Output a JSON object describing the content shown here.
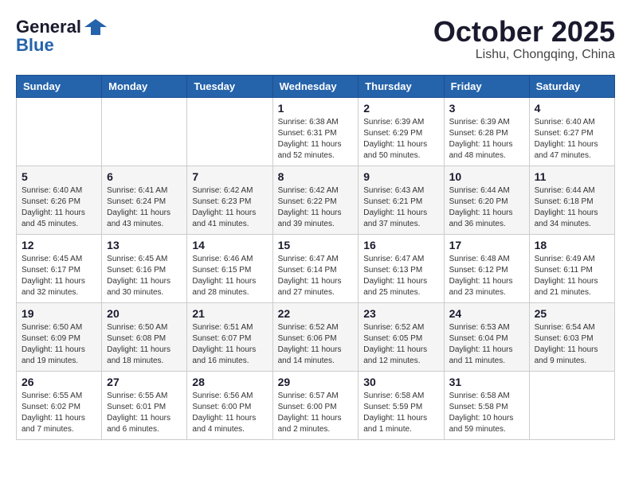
{
  "header": {
    "logo_general": "General",
    "logo_blue": "Blue",
    "month": "October 2025",
    "location": "Lishu, Chongqing, China"
  },
  "days_of_week": [
    "Sunday",
    "Monday",
    "Tuesday",
    "Wednesday",
    "Thursday",
    "Friday",
    "Saturday"
  ],
  "weeks": [
    [
      {
        "day": "",
        "info": ""
      },
      {
        "day": "",
        "info": ""
      },
      {
        "day": "",
        "info": ""
      },
      {
        "day": "1",
        "info": "Sunrise: 6:38 AM\nSunset: 6:31 PM\nDaylight: 11 hours and 52 minutes."
      },
      {
        "day": "2",
        "info": "Sunrise: 6:39 AM\nSunset: 6:29 PM\nDaylight: 11 hours and 50 minutes."
      },
      {
        "day": "3",
        "info": "Sunrise: 6:39 AM\nSunset: 6:28 PM\nDaylight: 11 hours and 48 minutes."
      },
      {
        "day": "4",
        "info": "Sunrise: 6:40 AM\nSunset: 6:27 PM\nDaylight: 11 hours and 47 minutes."
      }
    ],
    [
      {
        "day": "5",
        "info": "Sunrise: 6:40 AM\nSunset: 6:26 PM\nDaylight: 11 hours and 45 minutes."
      },
      {
        "day": "6",
        "info": "Sunrise: 6:41 AM\nSunset: 6:24 PM\nDaylight: 11 hours and 43 minutes."
      },
      {
        "day": "7",
        "info": "Sunrise: 6:42 AM\nSunset: 6:23 PM\nDaylight: 11 hours and 41 minutes."
      },
      {
        "day": "8",
        "info": "Sunrise: 6:42 AM\nSunset: 6:22 PM\nDaylight: 11 hours and 39 minutes."
      },
      {
        "day": "9",
        "info": "Sunrise: 6:43 AM\nSunset: 6:21 PM\nDaylight: 11 hours and 37 minutes."
      },
      {
        "day": "10",
        "info": "Sunrise: 6:44 AM\nSunset: 6:20 PM\nDaylight: 11 hours and 36 minutes."
      },
      {
        "day": "11",
        "info": "Sunrise: 6:44 AM\nSunset: 6:18 PM\nDaylight: 11 hours and 34 minutes."
      }
    ],
    [
      {
        "day": "12",
        "info": "Sunrise: 6:45 AM\nSunset: 6:17 PM\nDaylight: 11 hours and 32 minutes."
      },
      {
        "day": "13",
        "info": "Sunrise: 6:45 AM\nSunset: 6:16 PM\nDaylight: 11 hours and 30 minutes."
      },
      {
        "day": "14",
        "info": "Sunrise: 6:46 AM\nSunset: 6:15 PM\nDaylight: 11 hours and 28 minutes."
      },
      {
        "day": "15",
        "info": "Sunrise: 6:47 AM\nSunset: 6:14 PM\nDaylight: 11 hours and 27 minutes."
      },
      {
        "day": "16",
        "info": "Sunrise: 6:47 AM\nSunset: 6:13 PM\nDaylight: 11 hours and 25 minutes."
      },
      {
        "day": "17",
        "info": "Sunrise: 6:48 AM\nSunset: 6:12 PM\nDaylight: 11 hours and 23 minutes."
      },
      {
        "day": "18",
        "info": "Sunrise: 6:49 AM\nSunset: 6:11 PM\nDaylight: 11 hours and 21 minutes."
      }
    ],
    [
      {
        "day": "19",
        "info": "Sunrise: 6:50 AM\nSunset: 6:09 PM\nDaylight: 11 hours and 19 minutes."
      },
      {
        "day": "20",
        "info": "Sunrise: 6:50 AM\nSunset: 6:08 PM\nDaylight: 11 hours and 18 minutes."
      },
      {
        "day": "21",
        "info": "Sunrise: 6:51 AM\nSunset: 6:07 PM\nDaylight: 11 hours and 16 minutes."
      },
      {
        "day": "22",
        "info": "Sunrise: 6:52 AM\nSunset: 6:06 PM\nDaylight: 11 hours and 14 minutes."
      },
      {
        "day": "23",
        "info": "Sunrise: 6:52 AM\nSunset: 6:05 PM\nDaylight: 11 hours and 12 minutes."
      },
      {
        "day": "24",
        "info": "Sunrise: 6:53 AM\nSunset: 6:04 PM\nDaylight: 11 hours and 11 minutes."
      },
      {
        "day": "25",
        "info": "Sunrise: 6:54 AM\nSunset: 6:03 PM\nDaylight: 11 hours and 9 minutes."
      }
    ],
    [
      {
        "day": "26",
        "info": "Sunrise: 6:55 AM\nSunset: 6:02 PM\nDaylight: 11 hours and 7 minutes."
      },
      {
        "day": "27",
        "info": "Sunrise: 6:55 AM\nSunset: 6:01 PM\nDaylight: 11 hours and 6 minutes."
      },
      {
        "day": "28",
        "info": "Sunrise: 6:56 AM\nSunset: 6:00 PM\nDaylight: 11 hours and 4 minutes."
      },
      {
        "day": "29",
        "info": "Sunrise: 6:57 AM\nSunset: 6:00 PM\nDaylight: 11 hours and 2 minutes."
      },
      {
        "day": "30",
        "info": "Sunrise: 6:58 AM\nSunset: 5:59 PM\nDaylight: 11 hours and 1 minute."
      },
      {
        "day": "31",
        "info": "Sunrise: 6:58 AM\nSunset: 5:58 PM\nDaylight: 10 hours and 59 minutes."
      },
      {
        "day": "",
        "info": ""
      }
    ]
  ]
}
